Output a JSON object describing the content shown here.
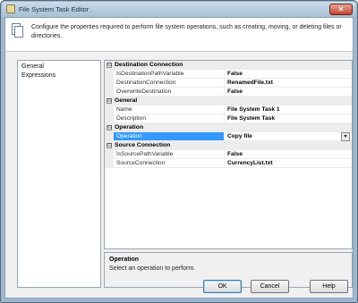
{
  "window": {
    "title": "File System Task Editor",
    "close_glyph": "✕"
  },
  "header": {
    "description": "Configure the properties required to perform file system operations, such as creating, moving, or deleting files or directories."
  },
  "nav": {
    "items": [
      "General",
      "Expressions"
    ]
  },
  "grid": {
    "categories": [
      {
        "label": "Destination Connection",
        "expander": "⊟"
      },
      {
        "label": "General",
        "expander": "⊟"
      },
      {
        "label": "Operation",
        "expander": "⊟"
      },
      {
        "label": "Source Connection",
        "expander": "⊟"
      }
    ],
    "properties": [
      {
        "name": "IsDestinationPathVariable",
        "value": "False"
      },
      {
        "name": "DestinationConnection",
        "value": "RenamedFile.txt"
      },
      {
        "name": "OverwriteDestination",
        "value": "False"
      },
      {
        "name": "Name",
        "value": "File System Task 1"
      },
      {
        "name": "Description",
        "value": "File System Task"
      },
      {
        "name": "Operation",
        "value": "Copy file"
      },
      {
        "name": "IsSourcePathVariable",
        "value": "False"
      },
      {
        "name": "SourceConnection",
        "value": "CurrencyList.txt"
      }
    ],
    "dropdown_glyph": "▾"
  },
  "description_panel": {
    "title": "Operation",
    "text": "Select an operation to perform."
  },
  "buttons": {
    "ok": "OK",
    "cancel": "Cancel",
    "help": "Help"
  },
  "colors": {
    "selection": "#3399ff",
    "category_bg": "#ececec"
  }
}
